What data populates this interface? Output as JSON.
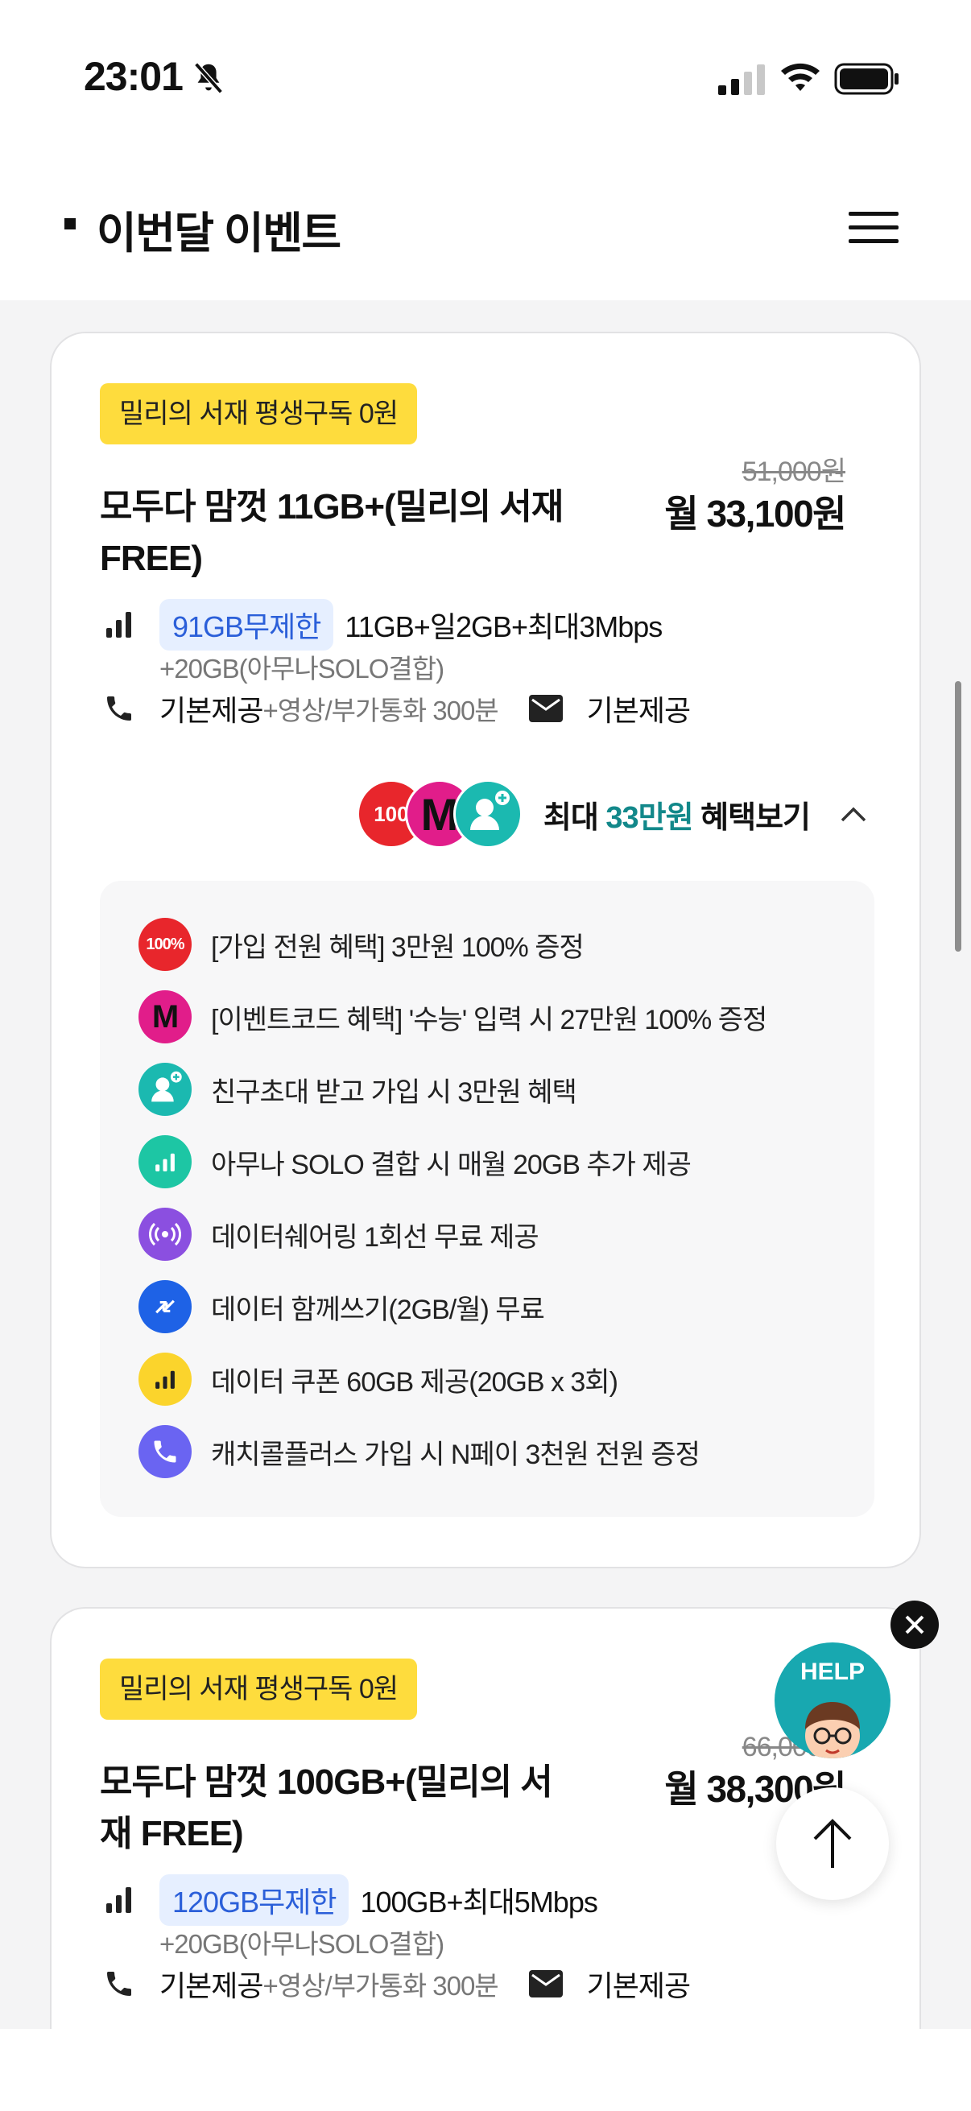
{
  "status_bar": {
    "time": "23:01"
  },
  "header": {
    "title": "이번달 이벤트"
  },
  "plans": [
    {
      "badge": "밀리의 서재 평생구독 0원",
      "title": "모두다 맘껏 11GB+(밀리의 서재 FREE)",
      "original_price": "51,000원",
      "price": "월 33,100원",
      "data_badge": "91GB무제한",
      "data_detail": "11GB+일2GB+최대3Mbps",
      "data_extra": "+20GB(아무나SOLO결합)",
      "call_main": "기본제공",
      "call_sub": "+영상/부가통화 300분",
      "sms": "기본제공",
      "benefit_prefix": "최대 ",
      "benefit_amount": "33만원",
      "benefit_suffix": " 혜택보기",
      "benefits": [
        "[가입 전원 혜택] 3만원 100% 증정",
        "[이벤트코드 혜택] '수능' 입력 시 27만원 100% 증정",
        "친구초대 받고 가입 시 3만원 혜택",
        "아무나 SOLO 결합 시 매월 20GB 추가 제공",
        "데이터쉐어링 1회선 무료 제공",
        "데이터 함께쓰기(2GB/월) 무료",
        "데이터 쿠폰 60GB 제공(20GB x 3회)",
        "캐치콜플러스 가입 시 N페이 3천원 전원 증정"
      ]
    },
    {
      "badge": "밀리의 서재 평생구독 0원",
      "title": "모두다 맘껏 100GB+(밀리의 서재 FREE)",
      "original_price": "66,000원",
      "price": "월 38,300원",
      "data_badge": "120GB무제한",
      "data_detail": "100GB+최대5Mbps",
      "data_extra": "+20GB(아무나SOLO결합)",
      "call_main": "기본제공",
      "call_sub": "+영상/부가통화 300분",
      "sms": "기본제공"
    }
  ],
  "floating": {
    "help_label": "HELP"
  },
  "colors": {
    "badge_yellow": "#fedc3d",
    "accent_teal": "#12888a",
    "data_blue": "#2b5fd9"
  },
  "icons": [
    "bell-off-icon",
    "signal-icon",
    "wifi-icon",
    "battery-icon",
    "menu-icon",
    "chevron-up-icon",
    "phone-icon",
    "mail-icon",
    "close-icon",
    "arrow-up-icon"
  ]
}
